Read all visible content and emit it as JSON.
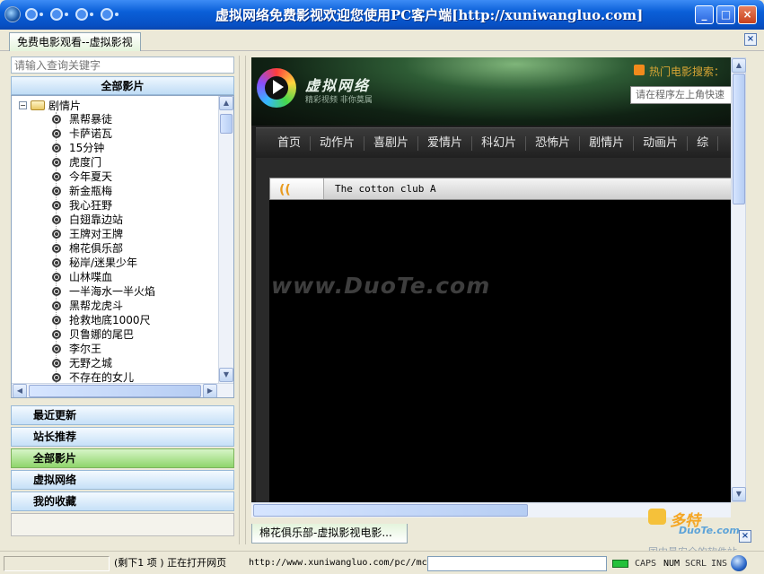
{
  "window": {
    "title": "虚拟网络免费影视欢迎您使用PC客户端[http://xuniwangluo.com]",
    "min_label": "_",
    "max_label": "□",
    "close_label": "×"
  },
  "main_tab": {
    "label": "免费电影观看--虚拟影视",
    "close": "×"
  },
  "left_panel": {
    "search_placeholder": "请输入查询关键字",
    "header": "全部影片",
    "tree_root": "剧情片",
    "tree_items": [
      "黑帮暴徒",
      "卡萨诺瓦",
      "15分钟",
      "虎度门",
      "今年夏天",
      "新金瓶梅",
      "我心狂野",
      "白翅靠边站",
      "王牌对王牌",
      "棉花俱乐部",
      "秘岸/迷果少年",
      "山林喋血",
      "一半海水一半火焰",
      "黑帮龙虎斗",
      "抢救地底1000尺",
      "贝鲁娜的尾巴",
      "李尔王",
      "无野之城",
      "不存在的女儿"
    ],
    "nav": [
      {
        "label": "最近更新",
        "active": false
      },
      {
        "label": "站长推荐",
        "active": false
      },
      {
        "label": "全部影片",
        "active": true
      },
      {
        "label": "虚拟网络",
        "active": false
      },
      {
        "label": "我的收藏",
        "active": false
      }
    ]
  },
  "site": {
    "logo_text": "虚拟网络",
    "logo_sub": "精彩视频 非你莫属",
    "hot_search": "热门电影搜索：",
    "search_placeholder": "请在程序左上角快速",
    "menu": [
      "首页",
      "动作片",
      "喜剧片",
      "爱情片",
      "科幻片",
      "恐怖片",
      "剧情片",
      "动画片",
      "综"
    ],
    "player_title": "The cotton club A",
    "player_icon": "((",
    "watermark": "www.DuoTe.com"
  },
  "browser_tab": {
    "label": "棉花俱乐部-虚拟影视电影...",
    "close": "×"
  },
  "overlay_watermark": {
    "brand": "多特",
    "sub": "DuoTe.com",
    "line": "国内最安全的软件站"
  },
  "status": {
    "remaining": "(剩下1 项 ) 正在打开网页",
    "url": "http://www.xuniwangluo.com/pc//mc",
    "caps": "CAPS",
    "num": "NUM",
    "scrl": "SCRL",
    "ins": "INS"
  },
  "colors": {
    "titlebar": "#0a5fd8",
    "active_nav": "#8fd56b",
    "hot_search": "#d7a534"
  }
}
